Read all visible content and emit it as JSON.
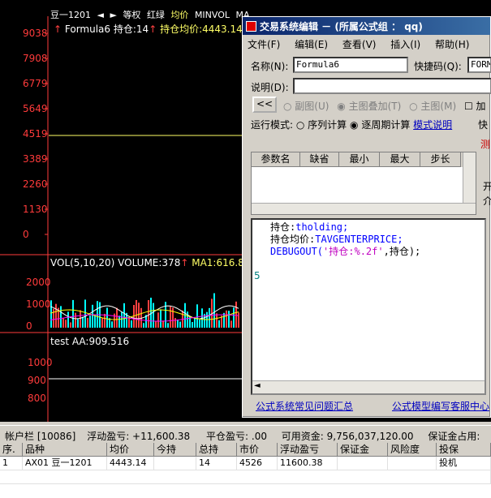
{
  "chart": {
    "top_bar": {
      "symbol": "豆一1201",
      "items": [
        "等权",
        "红绿",
        "均价",
        "MINVOL",
        "MA"
      ]
    },
    "formula_line": {
      "name": "Formula6",
      "hold": "持仓:14",
      "avg": "持仓均价:4443.14"
    },
    "price_axis": [
      "9038",
      "7908",
      "6779",
      "5649",
      "4519",
      "3389",
      "2260",
      "1130",
      "0"
    ],
    "volume_header": {
      "label": "VOL(5,10,20)",
      "volume": "VOLUME:378",
      "ma1": "MA1:616.8"
    },
    "volume_axis": [
      "2000",
      "1000",
      "0"
    ],
    "test_header": {
      "label": "test",
      "aa": "AA:909.516"
    },
    "test_axis": [
      "1000",
      "900",
      "800"
    ],
    "colors": {
      "axis": "#ff3b3b",
      "price_line": "#ffff66",
      "up": "#ff4040",
      "down": "#00ffff"
    }
  },
  "dialog": {
    "title": "交易系统编辑 － (所属公式组 ： qq)",
    "menu": [
      "文件(F)",
      "编辑(E)",
      "查看(V)",
      "插入(I)",
      "帮助(H)"
    ],
    "name_label": "名称(N):",
    "name_value": "Formula6",
    "shortcut_label": "快捷码(Q):",
    "shortcut_value": "FORM",
    "desc_label": "说明(D):",
    "collapse_btn": "<<",
    "radio_options": [
      "副图(U)",
      "主图叠加(T)",
      "主图(M)"
    ],
    "add_check": "加",
    "run_mode_label": "运行模式:",
    "run_modes": [
      "序列计算",
      "逐周期计算"
    ],
    "mode_help": "模式说明",
    "right_btn": "快",
    "param_headers": [
      "参数名",
      "缺省",
      "最小",
      "最大",
      "步长"
    ],
    "side_label_1": "测",
    "side_label_2": "开",
    "side_label_3": "介",
    "code_lines": [
      {
        "prefix": "持仓:",
        "rest": "tholding;"
      },
      {
        "prefix": "持仓均价:",
        "rest": "TAVGENTERPRICE;"
      },
      {
        "prefix": "DEBUGOUT(",
        "str": "'持仓:%.2f'",
        "tail": ",持仓);"
      }
    ],
    "line_number": "5",
    "footer_link_1": "公式系统常见问题汇总",
    "footer_link_2": "公式模型编写客服中心"
  },
  "status": {
    "account": "帐户栏 [10086]",
    "floating_pl": "浮动盈亏: +11,600.38",
    "closed_pl": "平仓盈亏: .00",
    "available": "可用资金: 9,756,037,120.00",
    "margin_used": "保证金占用:"
  },
  "positions": {
    "headers": [
      "序.",
      "品种",
      "均价",
      "今持",
      "总持",
      "市价",
      "浮动盈亏",
      "保证金",
      "风险度",
      "投保"
    ],
    "rows": [
      [
        "1",
        "AX01 豆一1201",
        "4443.14",
        "",
        "14",
        "4526",
        "11600.38",
        "",
        "",
        "投机"
      ]
    ]
  }
}
